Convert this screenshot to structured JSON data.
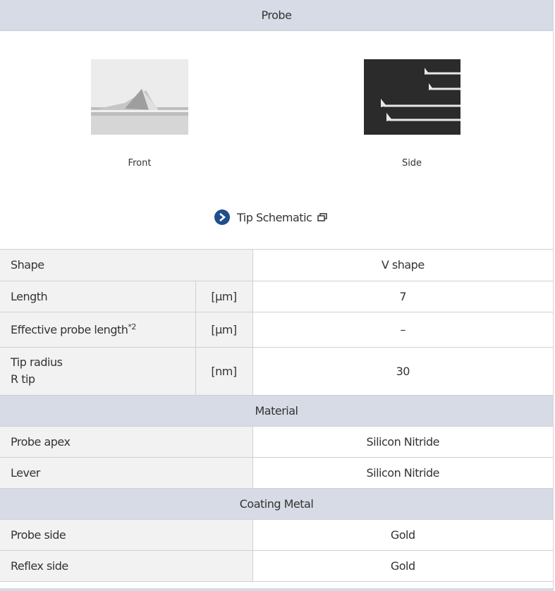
{
  "probe": {
    "title": "Probe",
    "images": {
      "front_caption": "Front",
      "side_caption": "Side"
    },
    "schematic_link": {
      "label": "Tip Schematic",
      "icon": "chevron-right-circle-icon",
      "external_icon": "new-window-icon"
    },
    "rows": [
      {
        "label": "Shape",
        "unit": "",
        "value": "V shape"
      },
      {
        "label": "Length",
        "unit": "[µm]",
        "value": "7"
      },
      {
        "label": "Effective probe length",
        "label_sup": "*2",
        "unit": "[µm]",
        "value": "–"
      },
      {
        "label": "Tip radius",
        "label_line2": "R tip",
        "unit": "[nm]",
        "value": "30"
      }
    ]
  },
  "material": {
    "title": "Material",
    "rows": [
      {
        "label": "Probe apex",
        "value": "Silicon Nitride"
      },
      {
        "label": "Lever",
        "value": "Silicon Nitride"
      }
    ]
  },
  "coating": {
    "title": "Coating Metal",
    "rows": [
      {
        "label": "Probe side",
        "value": "Gold"
      },
      {
        "label": "Reflex side",
        "value": "Gold"
      }
    ]
  },
  "colors": {
    "header_bg": "#d7dbe6",
    "label_bg": "#f2f2f2",
    "link_icon": "#1f4e8c"
  }
}
